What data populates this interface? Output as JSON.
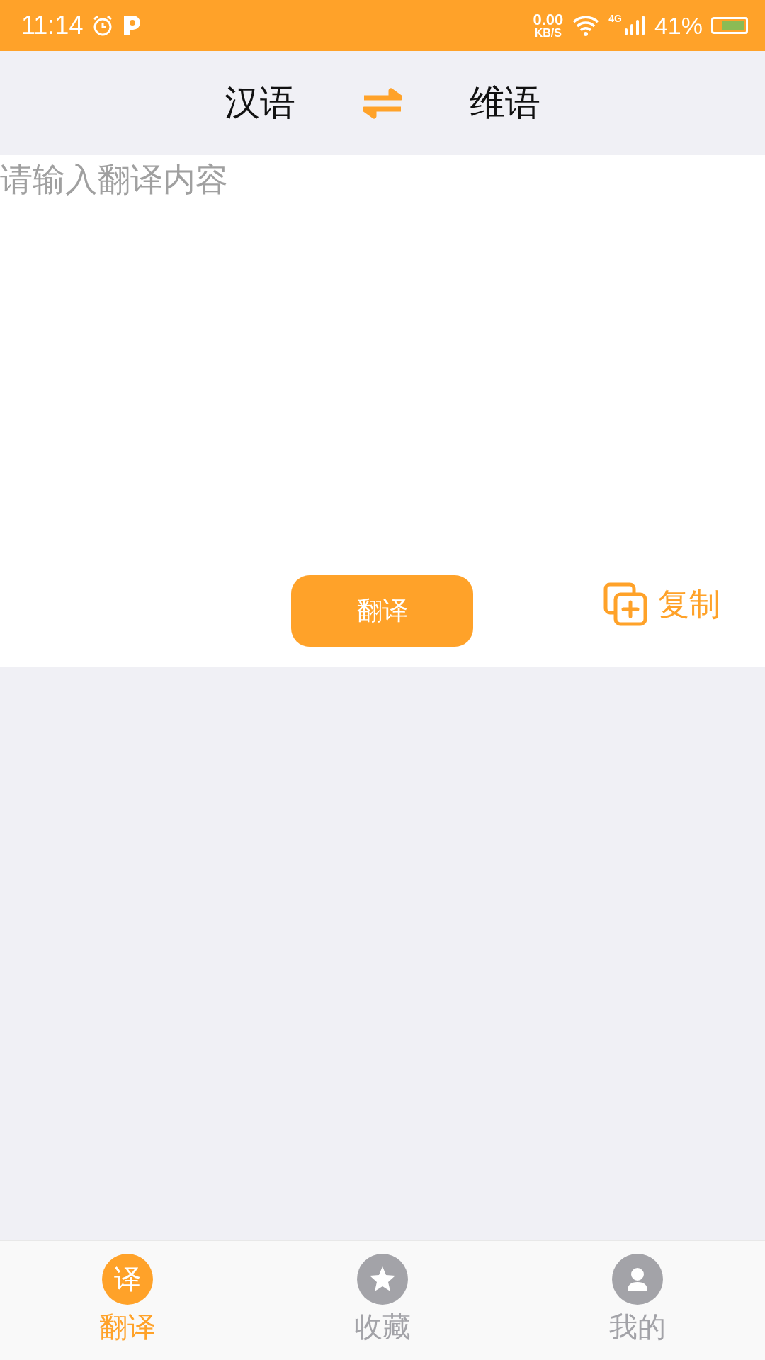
{
  "status_bar": {
    "time": "11:14",
    "speed_value": "0.00",
    "speed_unit": "KB/S",
    "network": "4G",
    "battery_text": "41%"
  },
  "languages": {
    "source": "汉语",
    "target": "维语"
  },
  "input": {
    "placeholder": "请输入翻译内容"
  },
  "translate_button": "翻译",
  "copy_button": "复制",
  "tabs": [
    {
      "kind": "text",
      "icon_text": "译",
      "label": "翻译",
      "selected": true
    },
    {
      "kind": "star",
      "label": "收藏",
      "selected": false
    },
    {
      "kind": "person",
      "label": "我的",
      "selected": false
    }
  ]
}
